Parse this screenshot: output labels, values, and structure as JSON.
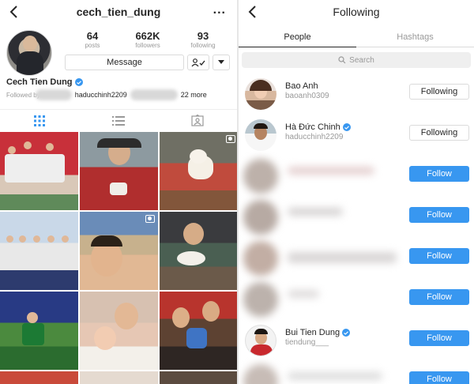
{
  "colors": {
    "accent": "#3897f0",
    "muted": "#999999",
    "text": "#262626"
  },
  "left": {
    "username": "cech_tien_dung",
    "more_icon": "...",
    "stats": [
      {
        "value": "64",
        "label": "posts"
      },
      {
        "value": "662K",
        "label": "followers"
      },
      {
        "value": "93",
        "label": "following"
      }
    ],
    "message_label": "Message",
    "display_name": "Cech Tien Dung",
    "followed_by_prefix": "Followed by",
    "followed_by_user": "haducchinh2209",
    "followed_by_more": "22 more",
    "tabs": [
      "grid-icon",
      "list-icon",
      "tagged-icon"
    ]
  },
  "right": {
    "title": "Following",
    "tabs": [
      {
        "label": "People",
        "active": true
      },
      {
        "label": "Hashtags",
        "active": false
      }
    ],
    "search_placeholder": "Search",
    "rows": [
      {
        "name": "Bao Anh",
        "handle": "baoanh0309",
        "verified": false,
        "button": "Following"
      },
      {
        "name": "Hà Đức Chinh",
        "handle": "haducchinh2209",
        "verified": true,
        "button": "Following"
      },
      {
        "name": "",
        "handle": "",
        "verified": false,
        "button": "Follow"
      },
      {
        "name": "",
        "handle": "",
        "verified": false,
        "button": "Follow"
      },
      {
        "name": "",
        "handle": "",
        "verified": false,
        "button": "Follow"
      },
      {
        "name": "",
        "handle": "",
        "verified": false,
        "button": "Follow"
      },
      {
        "name": "Bui Tien Dung",
        "handle": "tiendung___",
        "verified": true,
        "button": "Follow"
      },
      {
        "name": "",
        "handle": "",
        "verified": false,
        "button": "Follow"
      }
    ]
  }
}
